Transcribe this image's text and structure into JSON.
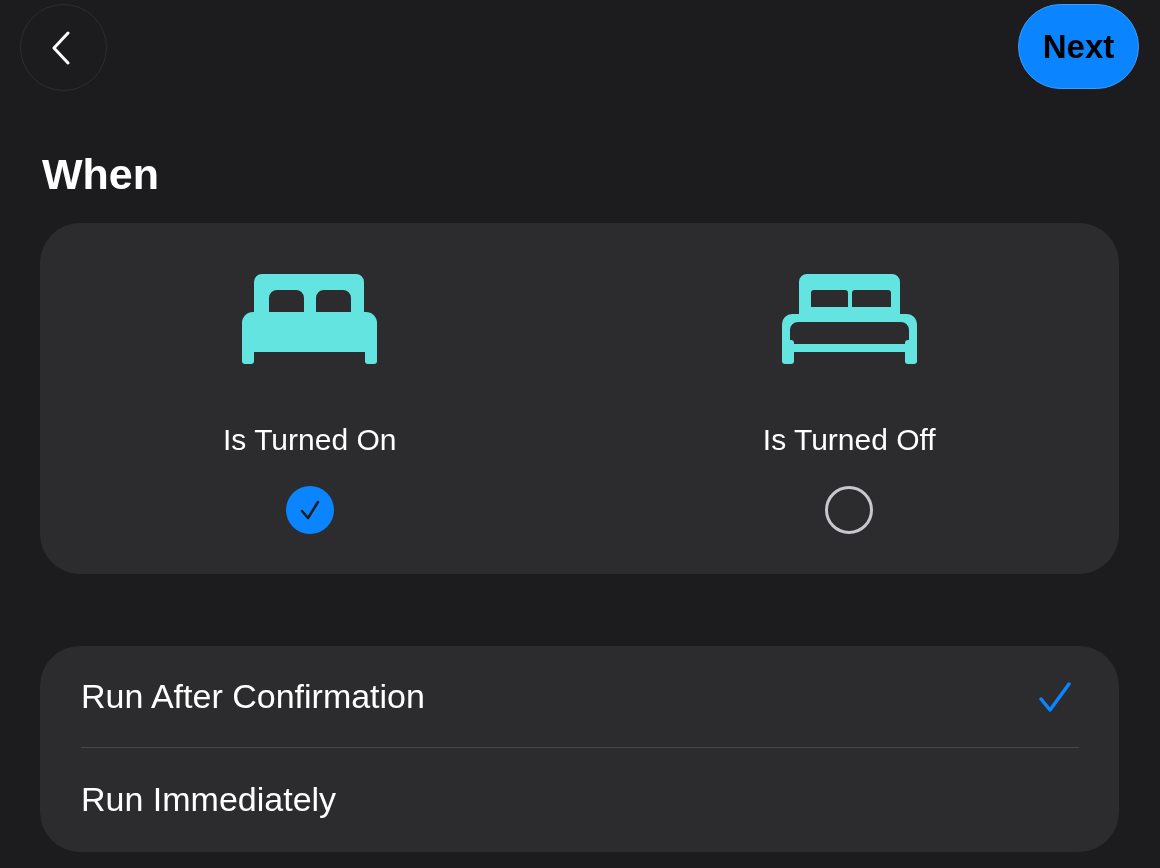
{
  "top_bar": {
    "next_button": "Next"
  },
  "heading": "When",
  "states": [
    {
      "label": "Is Turned On",
      "kind": "filled",
      "selected": true
    },
    {
      "label": "Is Turned Off",
      "kind": "outline",
      "selected": false
    }
  ],
  "run_options": [
    {
      "label": "Run After Confirmation",
      "selected": true
    },
    {
      "label": "Run Immediately",
      "selected": false
    }
  ]
}
